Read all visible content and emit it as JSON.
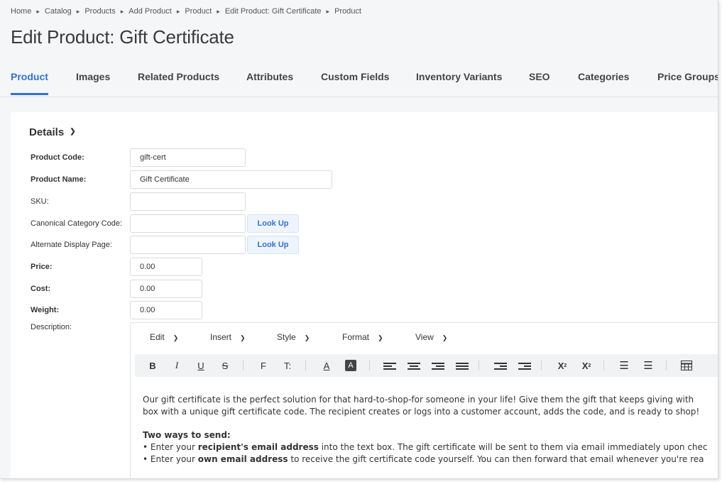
{
  "breadcrumb": [
    "Home",
    "Catalog",
    "Products",
    "Add Product",
    "Product",
    "Edit Product: Gift Certificate",
    "Product"
  ],
  "page_title": "Edit Product: Gift Certificate",
  "tabs": [
    "Product",
    "Images",
    "Related Products",
    "Attributes",
    "Custom Fields",
    "Inventory Variants",
    "SEO",
    "Categories",
    "Price Groups"
  ],
  "active_tab": "Product",
  "details": {
    "heading": "Details",
    "fields": {
      "product_code": {
        "label": "Product Code:",
        "value": "gift-cert"
      },
      "product_name": {
        "label": "Product Name:",
        "value": "Gift Certificate"
      },
      "sku": {
        "label": "SKU:",
        "value": ""
      },
      "canonical_category_code": {
        "label": "Canonical Category Code:",
        "value": "",
        "button": "Look Up"
      },
      "alternate_display_page": {
        "label": "Alternate Display Page:",
        "value": "",
        "button": "Look Up"
      },
      "price": {
        "label": "Price:",
        "value": "0.00"
      },
      "cost": {
        "label": "Cost:",
        "value": "0.00"
      },
      "weight": {
        "label": "Weight:",
        "value": "0.00"
      },
      "description": {
        "label": "Description:"
      }
    }
  },
  "editor": {
    "menus": [
      "Edit",
      "Insert",
      "Style",
      "Format",
      "View"
    ],
    "toolbar": {
      "bold": "B",
      "italic": "I",
      "underline": "U",
      "strike": "S",
      "font": "F",
      "text_size": "T:",
      "text_color": "A",
      "bg_color": "A",
      "superscript": "X",
      "subscript": "X"
    },
    "content": {
      "para1_line1": "Our gift certificate is the perfect solution for that hard-to-shop-for someone in your life! Give them the gift that keeps giving with",
      "para1_line2": "box with a unique gift certificate code. The recipient creates or logs into a customer account, adds the code, and is ready to shop!",
      "heading": "Two ways to send:",
      "bullet1_pre": "Enter your ",
      "bullet1_bold": "recipient's email address",
      "bullet1_post": " into the text box. The gift certificate will be sent to them via email immediately upon chec",
      "bullet2_pre": "Enter your ",
      "bullet2_bold": "own email address",
      "bullet2_post": " to receive the gift certificate code yourself. You can then forward that email whenever you're rea"
    }
  },
  "colors": {
    "accent": "#2f73d6",
    "background": "#f5f6f8",
    "panel": "#ffffff"
  }
}
